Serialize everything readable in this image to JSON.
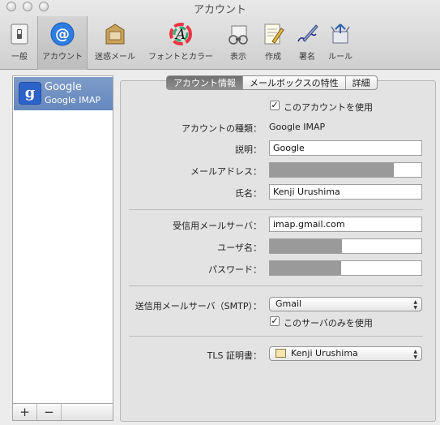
{
  "window": {
    "title": "アカウント"
  },
  "toolbar": {
    "items": [
      {
        "label": "一般",
        "icon": "switch-icon"
      },
      {
        "label": "アカウント",
        "icon": "at-sign-icon"
      },
      {
        "label": "迷惑メール",
        "icon": "junk-mail-icon"
      },
      {
        "label": "フォントとカラー",
        "icon": "font-color-icon"
      },
      {
        "label": "表示",
        "icon": "view-icon"
      },
      {
        "label": "作成",
        "icon": "compose-icon"
      },
      {
        "label": "署名",
        "icon": "signature-icon"
      },
      {
        "label": "ルール",
        "icon": "rules-icon"
      }
    ]
  },
  "accounts": [
    {
      "name": "Google",
      "type": "Google IMAP"
    }
  ],
  "list_footer": {
    "add": "+",
    "remove": "−"
  },
  "tabs": [
    {
      "label": "アカウント情報",
      "active": true
    },
    {
      "label": "メールボックスの特性",
      "active": false
    },
    {
      "label": "詳細",
      "active": false
    }
  ],
  "form": {
    "enable_account": {
      "label": "このアカウントを使用",
      "checked": true
    },
    "account_type": {
      "label": "アカウントの種類：",
      "value": "Google IMAP"
    },
    "description": {
      "label": "説明：",
      "value": "Google"
    },
    "email": {
      "label": "メールアドレス：",
      "value": ""
    },
    "full_name": {
      "label": "氏名：",
      "value": "Kenji Urushima"
    },
    "incoming_server": {
      "label": "受信用メールサーバ：",
      "value": "imap.gmail.com"
    },
    "username": {
      "label": "ユーザ名：",
      "value": ""
    },
    "password": {
      "label": "パスワード：",
      "value": ""
    },
    "smtp": {
      "label": "送信用メールサーバ（SMTP）：",
      "value": "Gmail"
    },
    "use_only_this_server": {
      "label": "このサーバのみを使用",
      "checked": true
    },
    "tls_cert": {
      "label": "TLS 証明書：",
      "value": "Kenji Urushima"
    }
  },
  "colors": {
    "selection": "#6f8fc4",
    "accent": "#2d63c8"
  }
}
